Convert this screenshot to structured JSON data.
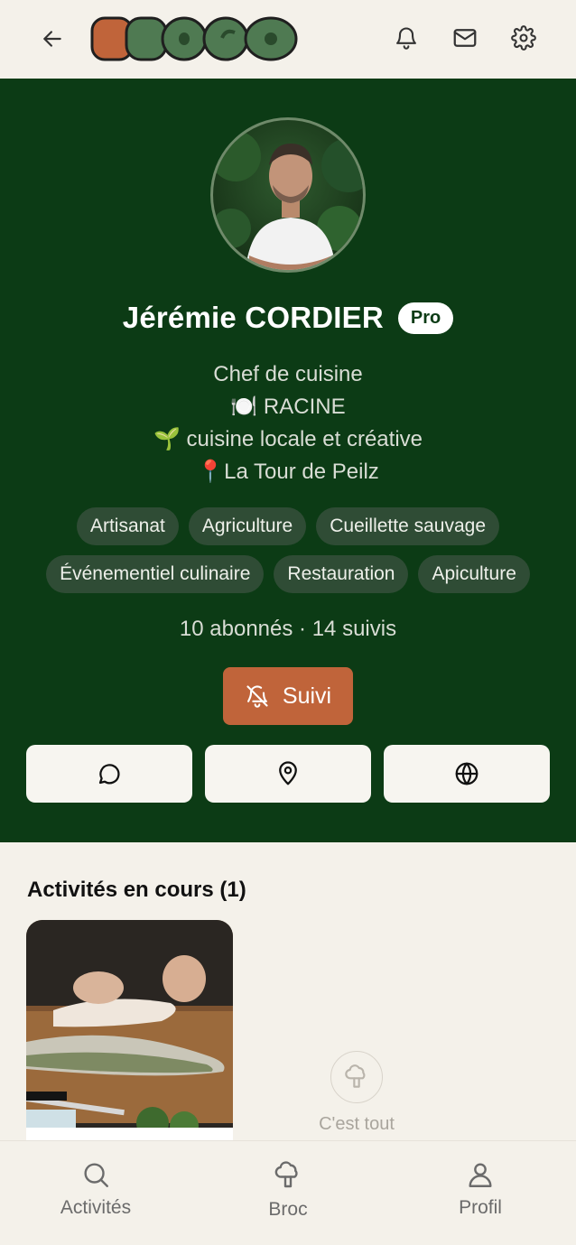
{
  "header": {
    "logo_text": "BROCO",
    "icons": [
      "arrow-left-icon",
      "bell-icon",
      "mail-icon",
      "gear-icon"
    ]
  },
  "profile": {
    "name": "Jérémie CORDIER",
    "badge": "Pro",
    "bio": {
      "line1": "Chef de cuisine",
      "line2": "🍽️ RACINE",
      "line3": "🌱 cuisine locale et créative",
      "line4": "📍La Tour de Peilz"
    },
    "tags": [
      "Artisanat",
      "Agriculture",
      "Cueillette sauvage",
      "Événementiel culinaire",
      "Restauration",
      "Apiculture"
    ],
    "stats": "10 abonnés · 14 suivis",
    "follow_button": "Suivi",
    "actions": [
      "chat-icon",
      "location-pin-icon",
      "globe-icon"
    ]
  },
  "activities": {
    "title": "Activités en cours (1)",
    "end_label": "C'est tout"
  },
  "bottom_nav": {
    "items": [
      {
        "label": "Activités",
        "icon": "search-icon"
      },
      {
        "label": "Broc",
        "icon": "broccoli-icon"
      },
      {
        "label": "Profil",
        "icon": "user-icon"
      }
    ]
  },
  "colors": {
    "profile_bg": "#0c3b15",
    "accent": "#c0643a",
    "page_bg": "#f4f1ea",
    "tag_bg": "#2f4c35"
  }
}
